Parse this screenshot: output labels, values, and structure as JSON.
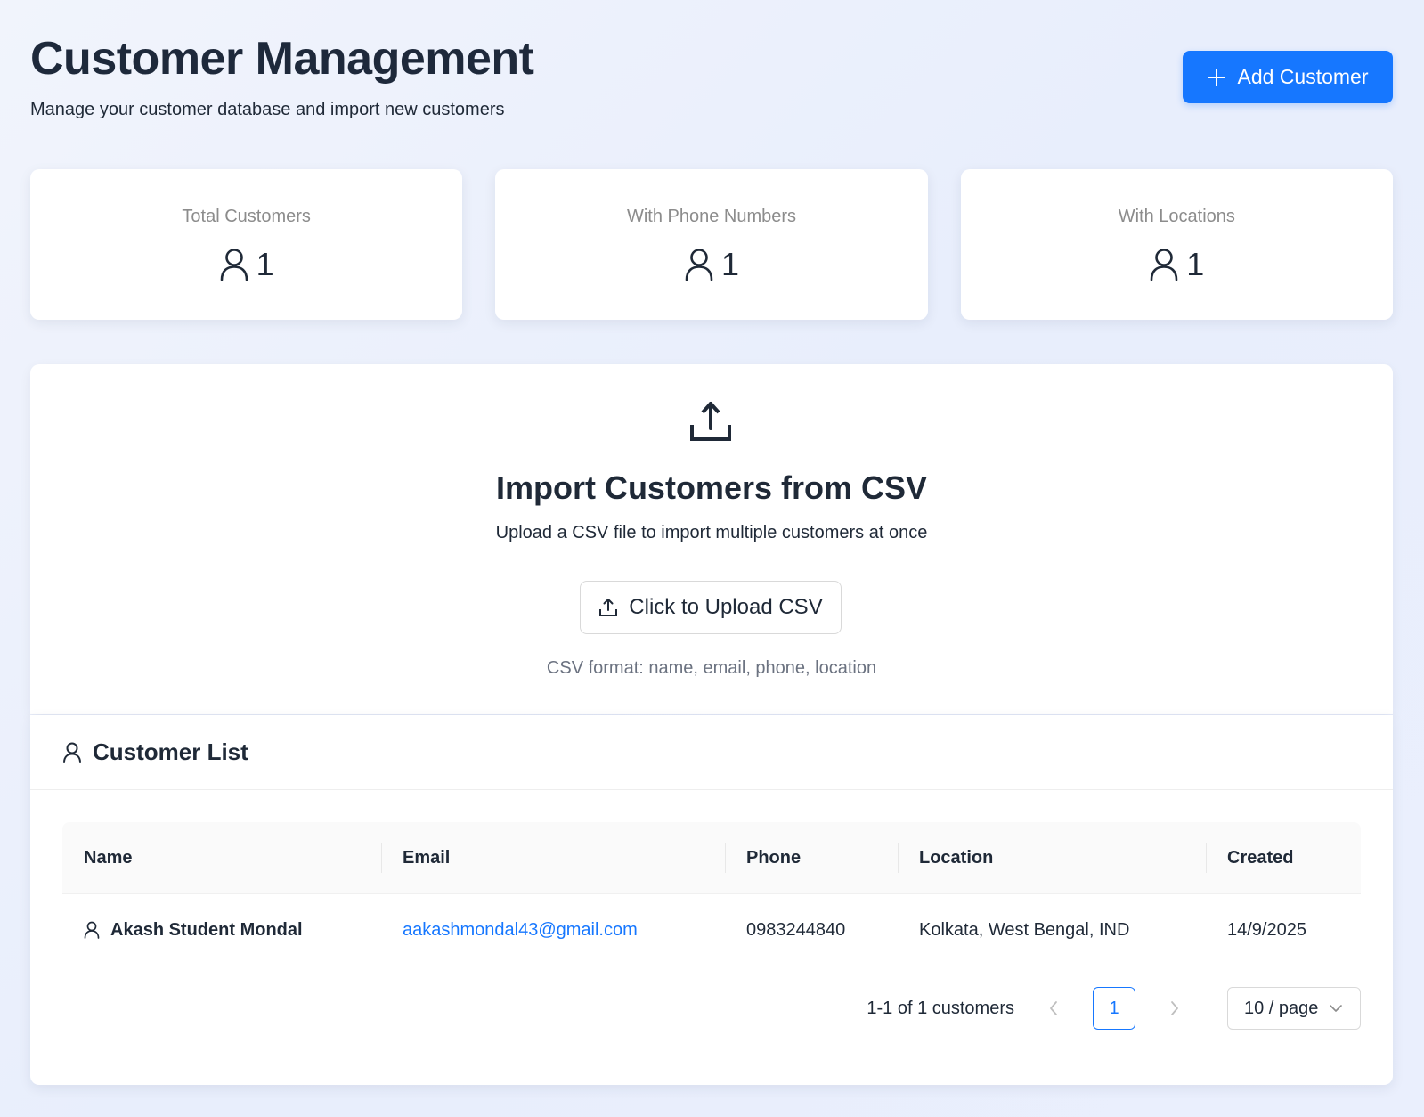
{
  "header": {
    "title": "Customer Management",
    "subtitle": "Manage your customer database and import new customers",
    "add_button_label": "Add Customer"
  },
  "stats": [
    {
      "label": "Total Customers",
      "value": "1",
      "icon": "user-icon"
    },
    {
      "label": "With Phone Numbers",
      "value": "1",
      "icon": "user-icon"
    },
    {
      "label": "With Locations",
      "value": "1",
      "icon": "user-icon"
    }
  ],
  "import": {
    "icon": "upload-icon",
    "title": "Import Customers from CSV",
    "description": "Upload a CSV file to import multiple customers at once",
    "upload_button_label": "Click to Upload CSV",
    "format_hint": "CSV format: name, email, phone, location"
  },
  "customer_list": {
    "title": "Customer List",
    "columns": [
      "Name",
      "Email",
      "Phone",
      "Location",
      "Created"
    ],
    "rows": [
      {
        "name": "Akash Student Mondal",
        "email": "aakashmondal43@gmail.com",
        "phone": "0983244840",
        "location": "Kolkata, West Bengal, IND",
        "created": "14/9/2025"
      }
    ],
    "pagination": {
      "total_text": "1-1 of 1 customers",
      "current_page": "1",
      "page_size": "10 / page"
    }
  },
  "colors": {
    "primary": "#1677ff",
    "title": "#1e293b",
    "muted": "#8c8c8c"
  }
}
